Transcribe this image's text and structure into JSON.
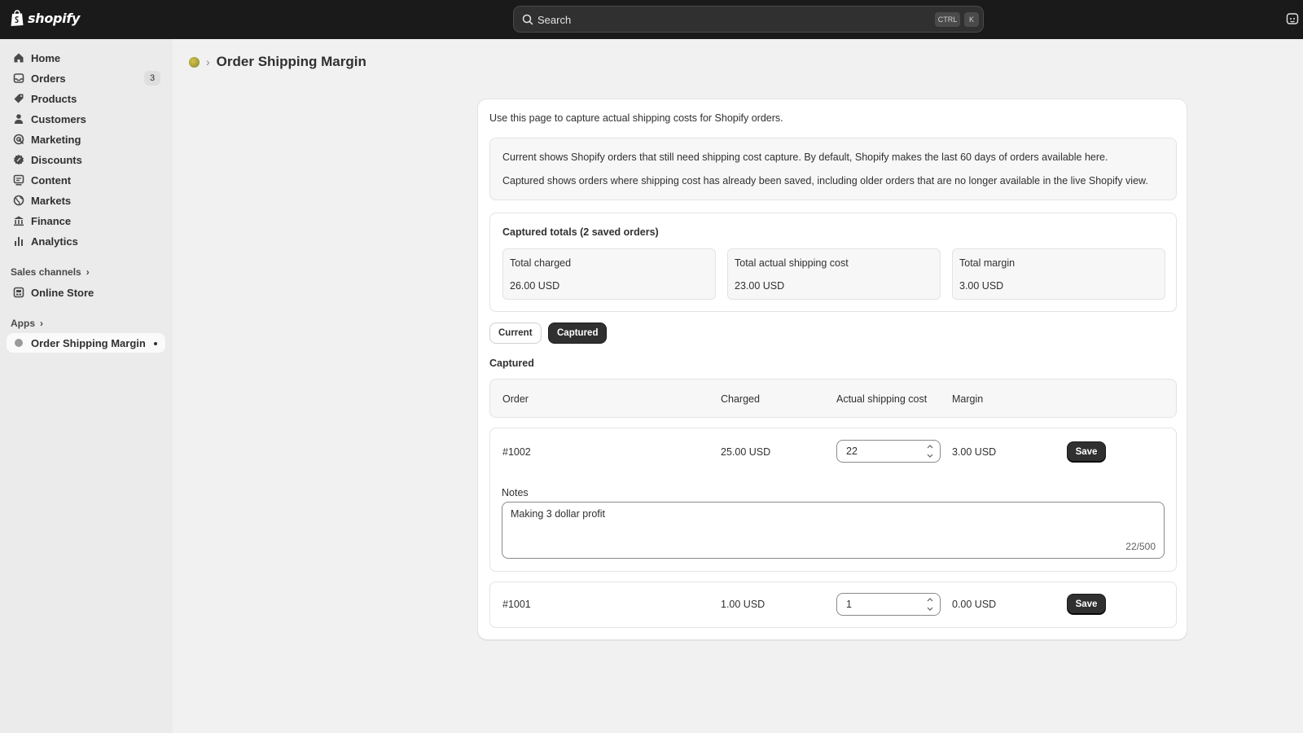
{
  "topbar": {
    "brand": "shopify",
    "search_placeholder": "Search",
    "shortcut_ctrl": "CTRL",
    "shortcut_key": "K"
  },
  "sidebar": {
    "items": [
      {
        "label": "Home",
        "icon": "home-icon"
      },
      {
        "label": "Orders",
        "icon": "inbox-icon",
        "badge": "3"
      },
      {
        "label": "Products",
        "icon": "tag-icon"
      },
      {
        "label": "Customers",
        "icon": "person-icon"
      },
      {
        "label": "Marketing",
        "icon": "target-icon"
      },
      {
        "label": "Discounts",
        "icon": "discount-icon"
      },
      {
        "label": "Content",
        "icon": "content-icon"
      },
      {
        "label": "Markets",
        "icon": "globe-icon"
      },
      {
        "label": "Finance",
        "icon": "bank-icon"
      },
      {
        "label": "Analytics",
        "icon": "bar-chart-icon"
      }
    ],
    "sales_channels_label": "Sales channels",
    "online_store_label": "Online Store",
    "apps_label": "Apps",
    "app_item_label": "Order Shipping Margin"
  },
  "page": {
    "title": "Order Shipping Margin",
    "intro": "Use this page to capture actual shipping costs for Shopify orders.",
    "info_line_1": "Current shows Shopify orders that still need shipping cost capture. By default, Shopify makes the last 60 days of orders available here.",
    "info_line_2": "Captured shows orders where shipping cost has already been saved, including older orders that are no longer available in the live Shopify view."
  },
  "totals": {
    "heading": "Captured totals (2 saved orders)",
    "charged_label": "Total charged",
    "charged_value": "26.00 USD",
    "actual_label": "Total actual shipping cost",
    "actual_value": "23.00 USD",
    "margin_label": "Total margin",
    "margin_value": "3.00 USD"
  },
  "tabs": {
    "current_label": "Current",
    "captured_label": "Captured",
    "selected": "Captured"
  },
  "table": {
    "section_title": "Captured",
    "headers": {
      "order": "Order",
      "charged": "Charged",
      "actual": "Actual shipping cost",
      "margin": "Margin"
    },
    "rows": [
      {
        "order": "#1002",
        "charged": "25.00 USD",
        "actual": "22",
        "margin": "3.00 USD",
        "save_label": "Save",
        "notes_label": "Notes",
        "notes": "Making 3 dollar profit",
        "notes_count": "22/500"
      },
      {
        "order": "#1001",
        "charged": "1.00 USD",
        "actual": "1",
        "margin": "0.00 USD",
        "save_label": "Save"
      }
    ]
  },
  "colors": {
    "topbar": "#1a1a1a",
    "sidebar": "#ebebeb",
    "page_bg": "#f1f1f1",
    "primary_button": "#303030"
  }
}
